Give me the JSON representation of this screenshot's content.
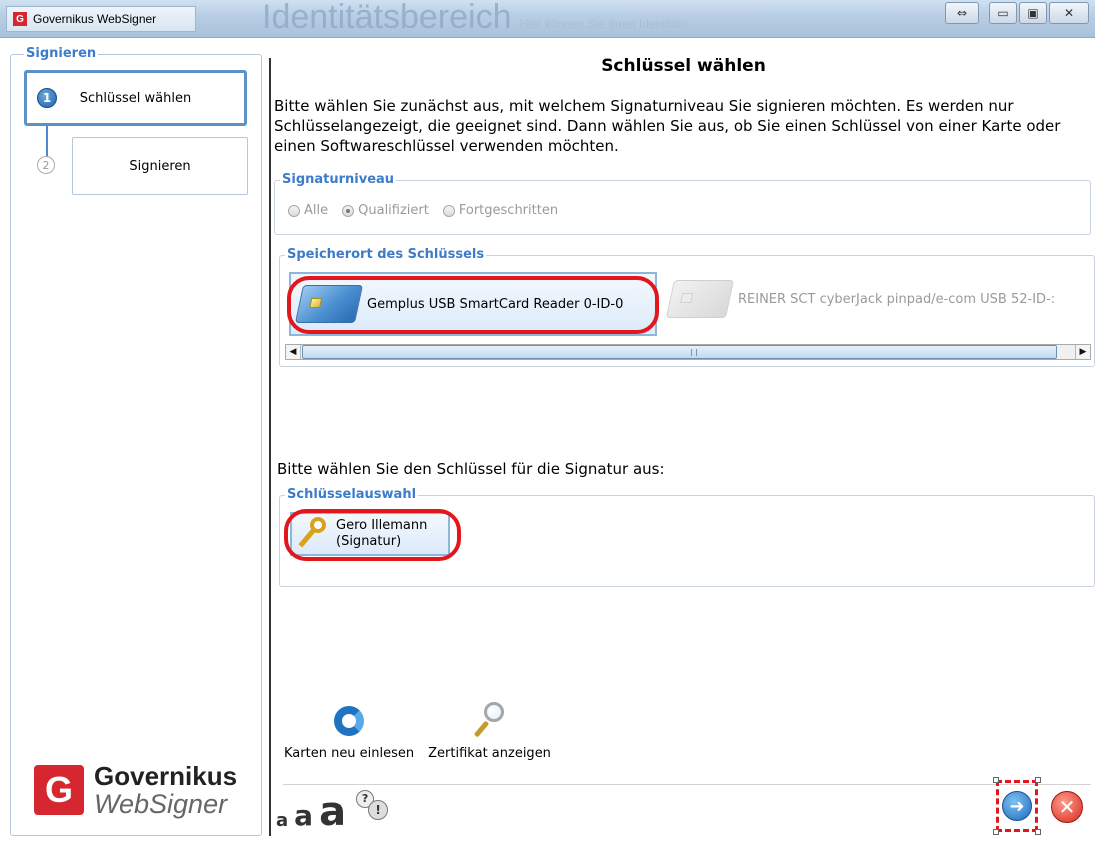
{
  "window": {
    "title": "Governikus WebSigner",
    "background_title": "Identitätsbereich",
    "background_subtitle": "Hier können Sie Ihren Identitäts",
    "buttons": [
      "⇔",
      "▭",
      "▣",
      "✕"
    ]
  },
  "sidebar": {
    "legend": "Signieren",
    "steps": [
      {
        "number": "1",
        "label": "Schlüssel wählen",
        "active": true
      },
      {
        "number": "2",
        "label": "Signieren",
        "active": false
      }
    ],
    "logo": {
      "mark": "G",
      "line1": "Governikus",
      "line2": "WebSigner"
    }
  },
  "main": {
    "title": "Schlüssel wählen",
    "intro": "Bitte wählen Sie zunächst aus, mit welchem Signaturniveau Sie signieren möchten. Es werden nur Schlüsselangezeigt, die geeignet sind. Dann wählen Sie aus, ob Sie einen Schlüssel von einer Karte oder einen Softwareschlüssel verwenden möchten.",
    "signature_level": {
      "legend": "Signaturniveau",
      "options": [
        {
          "label": "Alle",
          "checked": false
        },
        {
          "label": "Qualifiziert",
          "checked": true
        },
        {
          "label": "Fortgeschritten",
          "checked": false
        }
      ]
    },
    "key_location": {
      "legend": "Speicherort des Schlüssels",
      "items": [
        {
          "label": "Gemplus USB SmartCard Reader 0-ID-0",
          "icon": "smartcard-icon",
          "selected": true
        },
        {
          "label": "REINER SCT cyberJack pinpad/e-com USB 52-ID-:",
          "icon": "smartcard-icon",
          "selected": false
        }
      ],
      "scroll_left": "◀",
      "scroll_right": "▶"
    },
    "prompt_key": "Bitte wählen Sie den Schlüssel für die Signatur aus:",
    "key_selection": {
      "legend": "Schlüsselauswahl",
      "items": [
        {
          "line1": "Gero Illemann",
          "line2": "(Signatur)",
          "icon": "key-icon",
          "selected": true
        }
      ]
    },
    "tools": [
      {
        "label": "Karten neu einlesen",
        "icon": "refresh-icon"
      },
      {
        "label": "Zertifikat anzeigen",
        "icon": "magnifier-icon"
      }
    ],
    "font_sizes": [
      "a",
      "a",
      "a"
    ],
    "help_marks": [
      "?",
      "!"
    ],
    "next_symbol": "➜",
    "cancel_symbol": "✕"
  },
  "colors": {
    "accent": "#3d7cc9",
    "highlight_ring": "#e2161b",
    "logo_red": "#d6262f"
  }
}
